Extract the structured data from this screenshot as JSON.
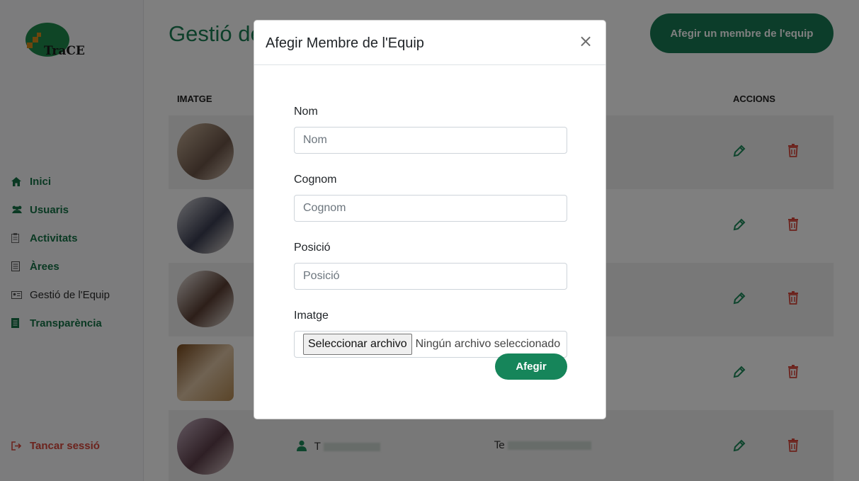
{
  "sidebar": {
    "logo_text": "TraCE",
    "items": [
      {
        "label": "Inici",
        "icon": "home-icon"
      },
      {
        "label": "Usuaris",
        "icon": "users-icon"
      },
      {
        "label": "Activitats",
        "icon": "clipboard-icon"
      },
      {
        "label": "Àrees",
        "icon": "list-icon"
      },
      {
        "label": "Gestió de l'Equip",
        "icon": "id-card-icon"
      },
      {
        "label": "Transparència",
        "icon": "document-icon"
      }
    ],
    "logout_label": "Tancar sessió"
  },
  "main": {
    "title": "Gestió de",
    "add_button": "Afegir un membre de l'equip",
    "columns": {
      "image": "IMATGE",
      "actions": "ACCIONS"
    },
    "last_row": {
      "name": "T",
      "position": "Te"
    }
  },
  "modal": {
    "title": "Afegir Membre de l'Equip",
    "close_symbol": "×",
    "fields": {
      "nom": {
        "label": "Nom",
        "placeholder": "Nom",
        "value": ""
      },
      "cognom": {
        "label": "Cognom",
        "placeholder": "Cognom",
        "value": ""
      },
      "posicio": {
        "label": "Posició",
        "placeholder": "Posició",
        "value": ""
      }
    },
    "image_field": {
      "label": "Imatge",
      "button": "Seleccionar archivo",
      "status": "Ningún archivo seleccionado"
    },
    "submit_label": "Afegir"
  },
  "colors": {
    "primary": "#187a54",
    "danger": "#d9463a"
  }
}
